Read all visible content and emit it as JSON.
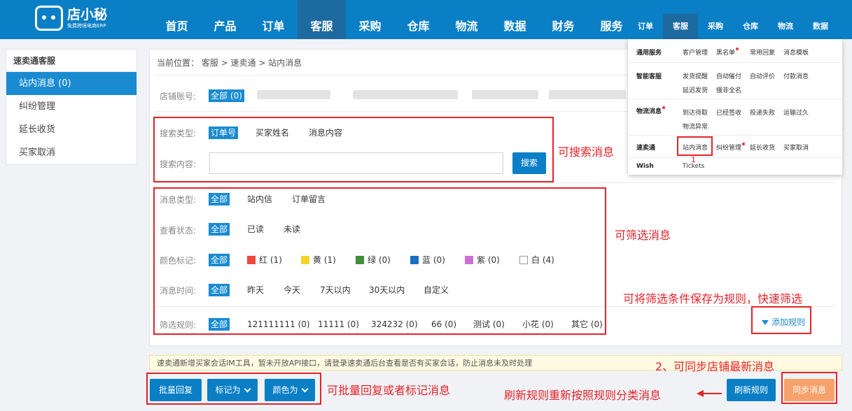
{
  "logo": {
    "name": "店小秘",
    "slogan": "免费跨境电商ERP"
  },
  "nav": {
    "items": [
      {
        "label": "首页"
      },
      {
        "label": "产品"
      },
      {
        "label": "订单"
      },
      {
        "label": "客服"
      },
      {
        "label": "采购"
      },
      {
        "label": "仓库"
      },
      {
        "label": "物流"
      },
      {
        "label": "数据"
      },
      {
        "label": "财务"
      },
      {
        "label": "服务"
      }
    ],
    "active": "客服"
  },
  "sidebar": {
    "title": "速卖通客服",
    "items": [
      {
        "label": "站内消息 (0)"
      },
      {
        "label": "纠纷管理"
      },
      {
        "label": "延长收货"
      },
      {
        "label": "买家取消"
      }
    ]
  },
  "breadcrumb": "当前位置： 客服 > 速卖通 > 站内消息",
  "shop": {
    "label": "店铺账号:",
    "all": "全部 (0)"
  },
  "search": {
    "type_label": "搜索类型:",
    "types": [
      "订单号",
      "买家姓名",
      "消息内容"
    ],
    "content_label": "搜索内容:",
    "input_value": "",
    "button": "搜索"
  },
  "filters": {
    "msg_type": {
      "label": "消息类型:",
      "options": [
        "全部",
        "站内信",
        "订单留言"
      ]
    },
    "read_status": {
      "label": "查看状态:",
      "options": [
        "全部",
        "已读",
        "未读"
      ]
    },
    "color": {
      "label": "颜色标记:",
      "all": "全部",
      "options": [
        {
          "label": "红 (1)",
          "color": "#f04a3a"
        },
        {
          "label": "黄 (1)",
          "color": "#f5d12b"
        },
        {
          "label": "绿 (0)",
          "color": "#3f8f3a"
        },
        {
          "label": "蓝 (0)",
          "color": "#1a6fc0"
        },
        {
          "label": "紫 (0)",
          "color": "#cc6ed6"
        },
        {
          "label": "白 (4)",
          "color": "#ffffff"
        }
      ]
    },
    "time": {
      "label": "消息时间:",
      "options": [
        "全部",
        "昨天",
        "今天",
        "7天以内",
        "30天以内",
        "自定义"
      ]
    },
    "rules": {
      "label": "筛选规则:",
      "options": [
        "全部",
        "121111111 (0)",
        "11111 (0)",
        "324232 (0)",
        "66 (0)",
        "测试 (0)",
        "小花 (0)",
        "其它 (0)"
      ]
    }
  },
  "add_rule": "添加规则",
  "notice": "速卖通新增买家会话IM工具，暂未开放API接口，请登录速卖通后台查看是否有买家会话，防止消息未及时处理",
  "bottom": {
    "batch_reply": "批量回复",
    "mark_as": "标记为",
    "color_as": "颜色为",
    "refresh_rules": "刷新规则",
    "sync_messages": "同步消息"
  },
  "annotations": {
    "search": "可搜索消息",
    "filter": "可筛选消息",
    "save_rule": "可将筛选条件保存为规则，快速筛选",
    "sync": "2、可同步店铺最新消息",
    "batch": "可批量回复或者标记消息",
    "refresh": "刷新规则重新按照规则分类消息",
    "step1": "1"
  },
  "dropdown": {
    "nav": [
      "订单",
      "客服",
      "采购",
      "仓库",
      "物流",
      "数据"
    ],
    "active": "客服",
    "rows": [
      {
        "category": "通用服务",
        "links": [
          "客户管理",
          "黑名单",
          "常用回复",
          "消息模板"
        ]
      },
      {
        "category": "智能客服",
        "links": [
          "发货提醒",
          "自动催付",
          "自动评价",
          "付款消息",
          "延迟发货",
          "俄非全名"
        ]
      },
      {
        "category": "物流消息",
        "links": [
          "到达待取",
          "已经签收",
          "投递失败",
          "运输过久",
          "物流异常"
        ]
      },
      {
        "category": "速卖通",
        "links": [
          "站内消息",
          "纠纷管理",
          "延长收货",
          "买家取消"
        ]
      },
      {
        "category": "Wish",
        "links": [
          "Tickets"
        ]
      }
    ]
  }
}
